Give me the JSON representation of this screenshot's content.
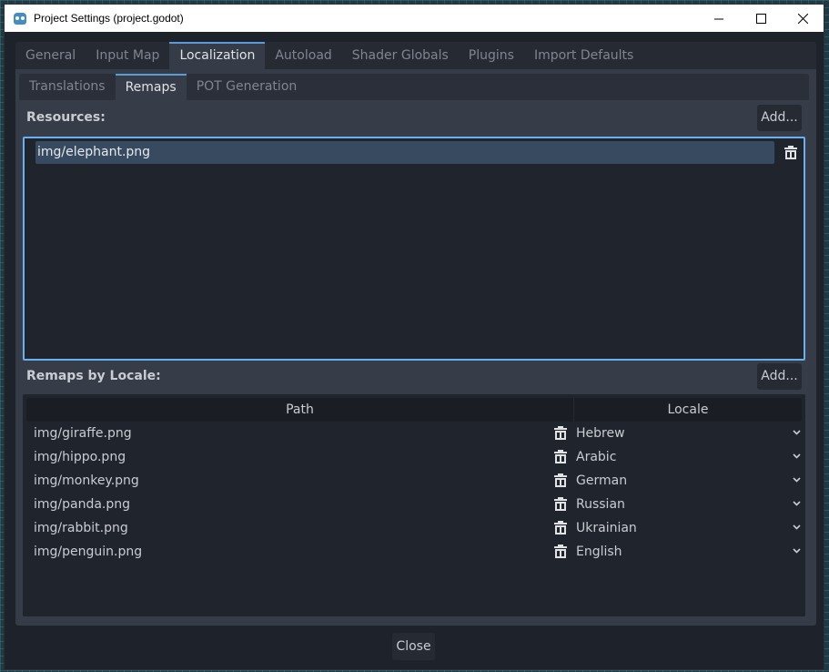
{
  "window": {
    "title": "Project Settings (project.godot)",
    "controls": {
      "minimize": "minimize",
      "maximize": "maximize",
      "close": "close"
    }
  },
  "main_tabs": [
    {
      "label": "General",
      "active": false
    },
    {
      "label": "Input Map",
      "active": false
    },
    {
      "label": "Localization",
      "active": true
    },
    {
      "label": "Autoload",
      "active": false
    },
    {
      "label": "Shader Globals",
      "active": false
    },
    {
      "label": "Plugins",
      "active": false
    },
    {
      "label": "Import Defaults",
      "active": false
    }
  ],
  "sub_tabs": [
    {
      "label": "Translations",
      "active": false
    },
    {
      "label": "Remaps",
      "active": true
    },
    {
      "label": "POT Generation",
      "active": false
    }
  ],
  "resources": {
    "label": "Resources:",
    "add_label": "Add...",
    "items": [
      {
        "path": "img/elephant.png",
        "selected": true
      }
    ]
  },
  "remaps": {
    "label": "Remaps by Locale:",
    "add_label": "Add...",
    "columns": {
      "path": "Path",
      "locale": "Locale"
    },
    "rows": [
      {
        "path": "img/giraffe.png",
        "locale": "Hebrew"
      },
      {
        "path": "img/hippo.png",
        "locale": "Arabic"
      },
      {
        "path": "img/monkey.png",
        "locale": "German"
      },
      {
        "path": "img/panda.png",
        "locale": "Russian"
      },
      {
        "path": "img/rabbit.png",
        "locale": "Ukrainian"
      },
      {
        "path": "img/penguin.png",
        "locale": "English"
      }
    ]
  },
  "footer": {
    "close_label": "Close"
  },
  "colors": {
    "accent": "#5b9bd5",
    "selection_border": "#6aafef",
    "selection_fill": "#374a60",
    "panel": "#363c48",
    "list_bg": "#20242c",
    "text": "#c9ccd2"
  }
}
